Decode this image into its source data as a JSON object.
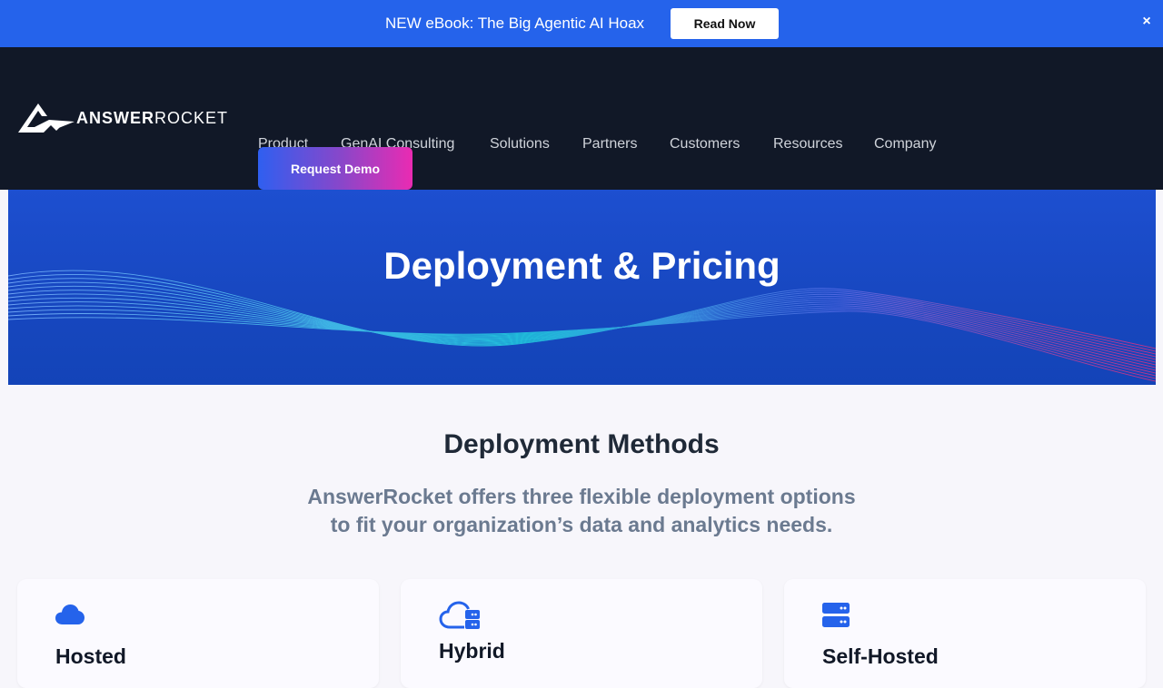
{
  "announcement": {
    "text": "NEW eBook: The Big Agentic AI Hoax",
    "button_label": "Read Now",
    "close_glyph": "×"
  },
  "logo": {
    "text_bold": "ANSWER",
    "text_light": "ROCKET",
    "icon": "rocket-logo-icon"
  },
  "nav": {
    "items": [
      {
        "label": "Product"
      },
      {
        "label": "GenAI Consulting"
      },
      {
        "label": "Solutions"
      },
      {
        "label": "Partners"
      },
      {
        "label": "Customers"
      },
      {
        "label": "Resources"
      },
      {
        "label": "Company"
      }
    ],
    "cta_label": "Request Demo"
  },
  "hero": {
    "title": "Deployment & Pricing"
  },
  "deployment": {
    "title": "Deployment Methods",
    "subtitle_line1": "AnswerRocket offers three flexible deployment options",
    "subtitle_line2": "to fit your organization’s data and analytics needs.",
    "cards": [
      {
        "title": "Hosted",
        "icon": "cloud-icon"
      },
      {
        "title": "Hybrid",
        "icon": "cloud-server-icon"
      },
      {
        "title": "Self-Hosted",
        "icon": "server-icon"
      }
    ]
  },
  "colors": {
    "announce_bg": "#2563eb",
    "nav_bg": "#111827",
    "hero_bg": "#1747bf",
    "accent_pink": "#ea2bb2",
    "icon_blue": "#2563eb"
  }
}
